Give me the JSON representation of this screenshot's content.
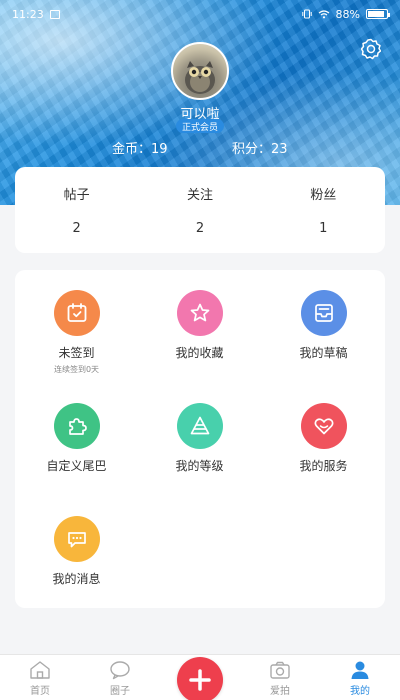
{
  "status_bar": {
    "time": "11:23",
    "battery": "88%",
    "battery_level": 0.88
  },
  "profile": {
    "username": "可以啦",
    "badge": "正式会员",
    "coins": "金币：19",
    "points": "积分：23"
  },
  "stats": [
    {
      "label": "帖子",
      "value": "2"
    },
    {
      "label": "关注",
      "value": "2"
    },
    {
      "label": "粉丝",
      "value": "1"
    }
  ],
  "menu": [
    {
      "label": "未签到",
      "sub": "连续签到0天",
      "icon": "calendar-check-icon",
      "color": "#f5894a"
    },
    {
      "label": "我的收藏",
      "icon": "star-icon",
      "color": "#f277ae"
    },
    {
      "label": "我的草稿",
      "icon": "drafts-box-icon",
      "color": "#5b8fe6"
    },
    {
      "label": "自定义尾巴",
      "icon": "puzzle-icon",
      "color": "#3fc385"
    },
    {
      "label": "我的等级",
      "icon": "level-pyramid-icon",
      "color": "#48d0ac"
    },
    {
      "label": "我的服务",
      "icon": "heart-icon",
      "color": "#f0535d"
    },
    {
      "label": "我的消息",
      "icon": "message-icon",
      "color": "#f8b63b"
    }
  ],
  "tabs": [
    {
      "label": "首页",
      "icon": "home-icon"
    },
    {
      "label": "圈子",
      "icon": "circle-chat-icon"
    },
    {
      "label": "",
      "icon": "plus-icon"
    },
    {
      "label": "爱拍",
      "icon": "camera-icon"
    },
    {
      "label": "我的",
      "icon": "person-icon"
    }
  ],
  "colors": {
    "accent": "#2a8be0",
    "post_button": "#ee3f4d"
  }
}
